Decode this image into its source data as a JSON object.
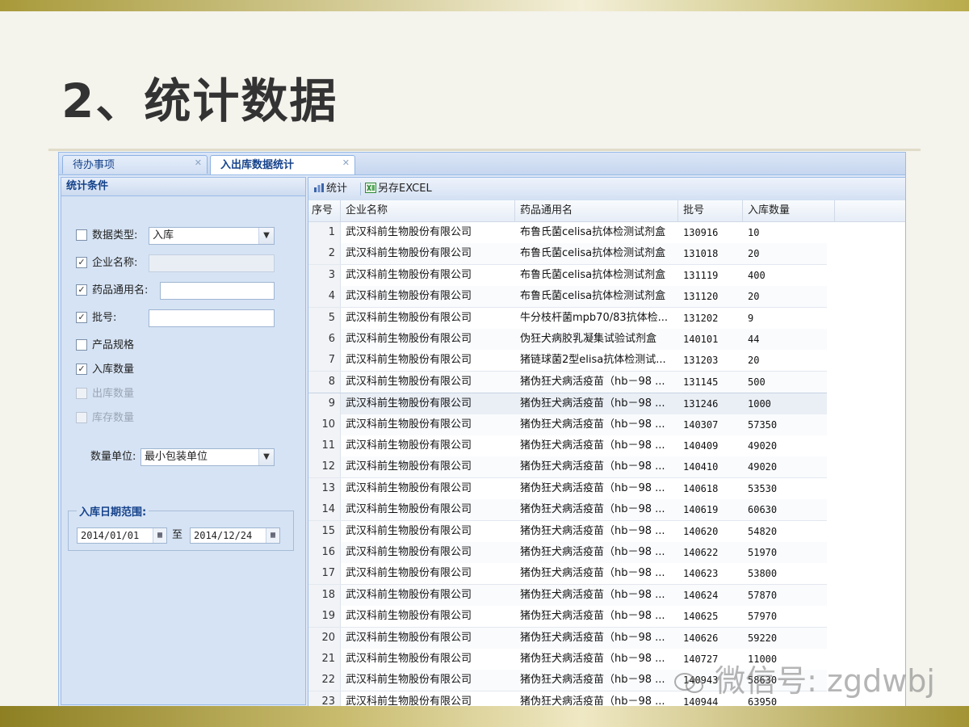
{
  "slide": {
    "title": "2、统计数据",
    "watermark": "微信号: zgdwbj"
  },
  "tabs": [
    {
      "label": "待办事项"
    },
    {
      "label": "入出库数据统计"
    }
  ],
  "left_panel": {
    "title": "统计条件",
    "filters": {
      "data_type": {
        "label": "数据类型:",
        "checked": false,
        "value": "入库"
      },
      "company": {
        "label": "企业名称:",
        "checked": true,
        "value": ""
      },
      "drug_name": {
        "label": "药品通用名:",
        "checked": true,
        "value": ""
      },
      "batch": {
        "label": "批号:",
        "checked": true,
        "value": ""
      },
      "spec": {
        "label": "产品规格",
        "checked": false
      },
      "in_qty": {
        "label": "入库数量",
        "checked": true
      },
      "out_qty": {
        "label": "出库数量",
        "checked": false,
        "disabled": true
      },
      "stock_qty": {
        "label": "库存数量",
        "checked": false,
        "disabled": true
      }
    },
    "unit": {
      "label": "数量单位:",
      "value": "最小包装单位"
    },
    "date_range": {
      "legend": "入库日期范围:",
      "from": "2014/01/01",
      "to_label": "至",
      "to": "2014/12/24"
    }
  },
  "toolbar": {
    "stat_label": "统计",
    "export_label": "另存EXCEL"
  },
  "grid": {
    "columns": [
      "序号",
      "企业名称",
      "药品通用名",
      "批号",
      "入库数量"
    ],
    "rows": [
      [
        "1",
        "武汉科前生物股份有限公司",
        "布鲁氏菌celisa抗体检测试剂盒",
        "130916",
        "10"
      ],
      [
        "2",
        "武汉科前生物股份有限公司",
        "布鲁氏菌celisa抗体检测试剂盒",
        "131018",
        "20"
      ],
      [
        "3",
        "武汉科前生物股份有限公司",
        "布鲁氏菌celisa抗体检测试剂盒",
        "131119",
        "400"
      ],
      [
        "4",
        "武汉科前生物股份有限公司",
        "布鲁氏菌celisa抗体检测试剂盒",
        "131120",
        "20"
      ],
      [
        "5",
        "武汉科前生物股份有限公司",
        "牛分枝杆菌mpb70/83抗体检...",
        "131202",
        "9"
      ],
      [
        "6",
        "武汉科前生物股份有限公司",
        "伪狂犬病胶乳凝集试验试剂盒",
        "140101",
        "44"
      ],
      [
        "7",
        "武汉科前生物股份有限公司",
        "猪链球菌2型elisa抗体检测试...",
        "131203",
        "20"
      ],
      [
        "8",
        "武汉科前生物股份有限公司",
        "猪伪狂犬病活疫苗（hb－98 ...",
        "131145",
        "500"
      ],
      [
        "9",
        "武汉科前生物股份有限公司",
        "猪伪狂犬病活疫苗（hb－98 ...",
        "131246",
        "1000"
      ],
      [
        "10",
        "武汉科前生物股份有限公司",
        "猪伪狂犬病活疫苗（hb－98 ...",
        "140307",
        "57350"
      ],
      [
        "11",
        "武汉科前生物股份有限公司",
        "猪伪狂犬病活疫苗（hb－98 ...",
        "140409",
        "49020"
      ],
      [
        "12",
        "武汉科前生物股份有限公司",
        "猪伪狂犬病活疫苗（hb－98 ...",
        "140410",
        "49020"
      ],
      [
        "13",
        "武汉科前生物股份有限公司",
        "猪伪狂犬病活疫苗（hb－98 ...",
        "140618",
        "53530"
      ],
      [
        "14",
        "武汉科前生物股份有限公司",
        "猪伪狂犬病活疫苗（hb－98 ...",
        "140619",
        "60630"
      ],
      [
        "15",
        "武汉科前生物股份有限公司",
        "猪伪狂犬病活疫苗（hb－98 ...",
        "140620",
        "54820"
      ],
      [
        "16",
        "武汉科前生物股份有限公司",
        "猪伪狂犬病活疫苗（hb－98 ...",
        "140622",
        "51970"
      ],
      [
        "17",
        "武汉科前生物股份有限公司",
        "猪伪狂犬病活疫苗（hb－98 ...",
        "140623",
        "53800"
      ],
      [
        "18",
        "武汉科前生物股份有限公司",
        "猪伪狂犬病活疫苗（hb－98 ...",
        "140624",
        "57870"
      ],
      [
        "19",
        "武汉科前生物股份有限公司",
        "猪伪狂犬病活疫苗（hb－98 ...",
        "140625",
        "57970"
      ],
      [
        "20",
        "武汉科前生物股份有限公司",
        "猪伪狂犬病活疫苗（hb－98 ...",
        "140626",
        "59220"
      ],
      [
        "21",
        "武汉科前生物股份有限公司",
        "猪伪狂犬病活疫苗（hb－98 ...",
        "140727",
        "11000"
      ],
      [
        "22",
        "武汉科前生物股份有限公司",
        "猪伪狂犬病活疫苗（hb－98 ...",
        "140943",
        "58630"
      ],
      [
        "23",
        "武汉科前生物股份有限公司",
        "猪伪狂犬病活疫苗（hb－98 ...",
        "140944",
        "63950"
      ]
    ],
    "selected_row": 9
  }
}
